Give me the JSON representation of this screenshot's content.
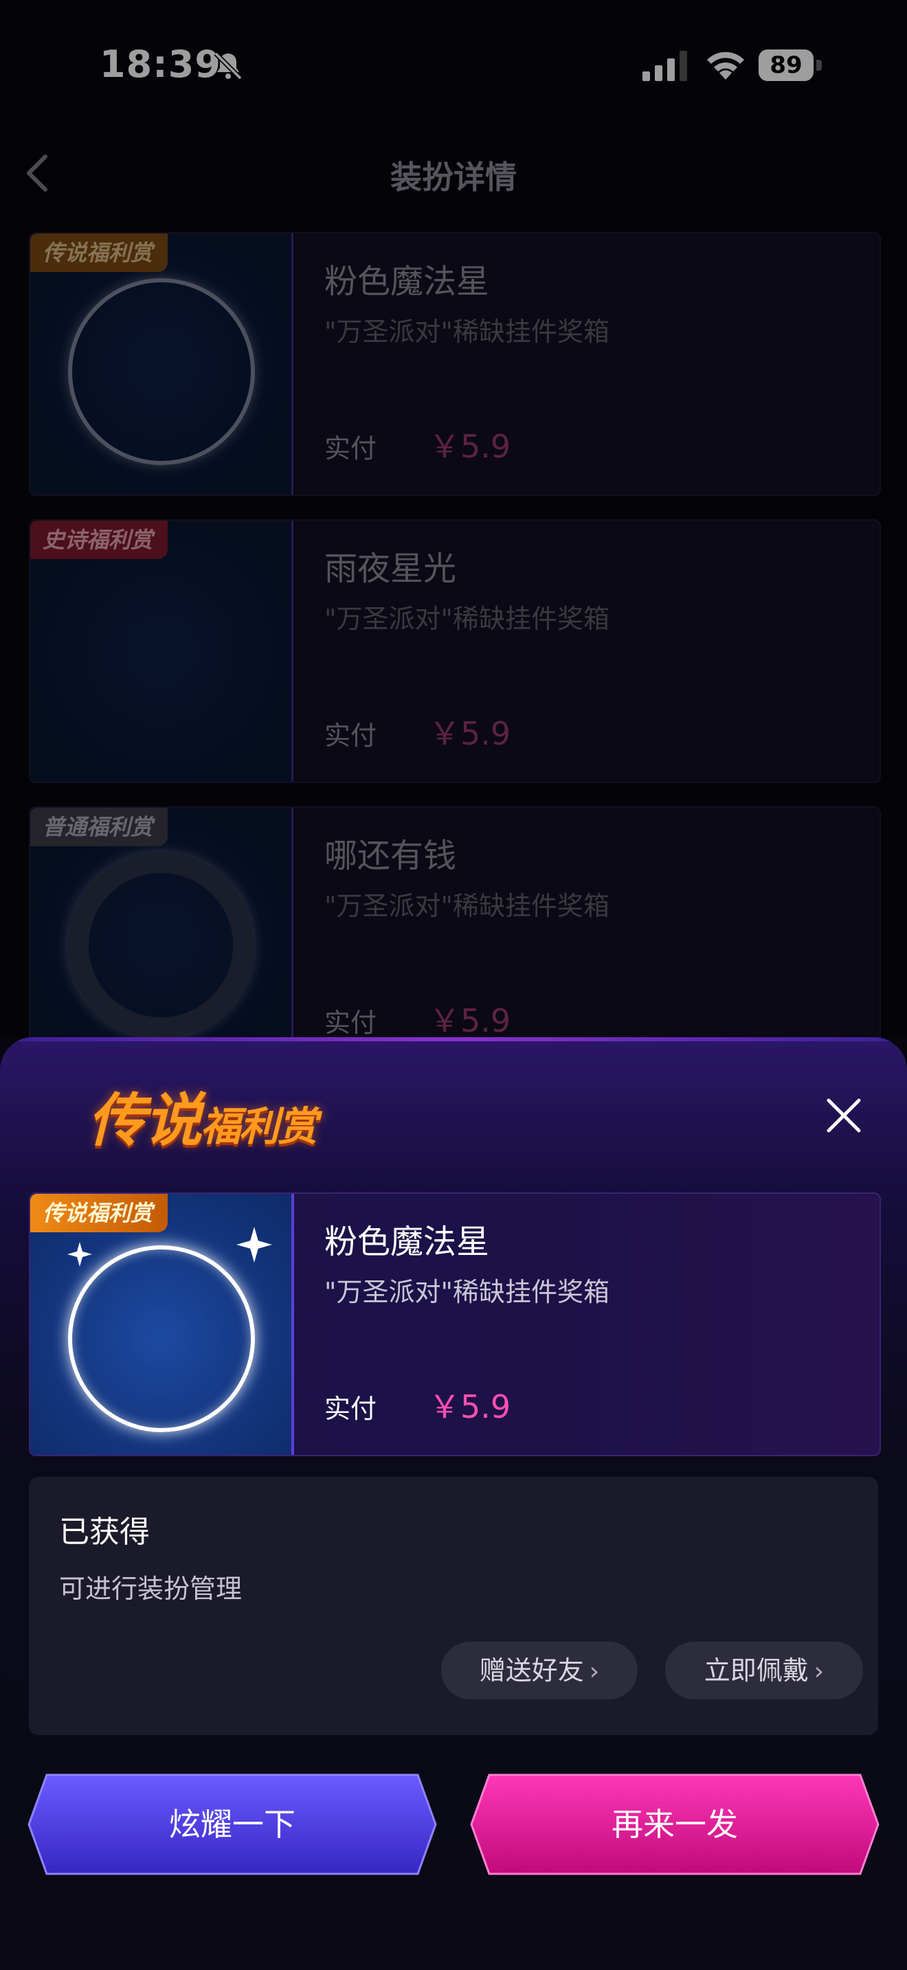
{
  "status_bar": {
    "time": "18:39",
    "battery": "89"
  },
  "nav": {
    "title": "装扮详情"
  },
  "list": [
    {
      "rarity": "传说福利赏",
      "rarity_color": "#7a4a12",
      "name": "粉色魔法星",
      "desc": "\"万圣派对\"稀缺挂件奖箱",
      "paid_label": "实付",
      "price": "￥5.9"
    },
    {
      "rarity": "史诗福利赏",
      "rarity_color": "#7a1a2c",
      "name": "雨夜星光",
      "desc": "\"万圣派对\"稀缺挂件奖箱",
      "paid_label": "实付",
      "price": "￥5.9"
    },
    {
      "rarity": "普通福利赏",
      "rarity_color": "#3a3a44",
      "name": "哪还有钱",
      "desc": "\"万圣派对\"稀缺挂件奖箱",
      "paid_label": "实付",
      "price": "￥5.9"
    }
  ],
  "sheet": {
    "title_main": "传说",
    "title_sub": "福利赏",
    "item": {
      "rarity": "传说福利赏",
      "name": "粉色魔法星",
      "desc": "\"万圣派对\"稀缺挂件奖箱",
      "paid_label": "实付",
      "price": "￥5.9"
    },
    "obtained": "已获得",
    "hint": "可进行装扮管理",
    "gift_label": "赠送好友",
    "wear_label": "立即佩戴",
    "show_label": "炫耀一下",
    "again_label": "再来一发"
  },
  "colors": {
    "accent_pink": "#ff4fb0",
    "btn_blue": "#4f3ee8",
    "btn_pink": "#e5148f",
    "legend_orange": "#ff9a1f"
  }
}
